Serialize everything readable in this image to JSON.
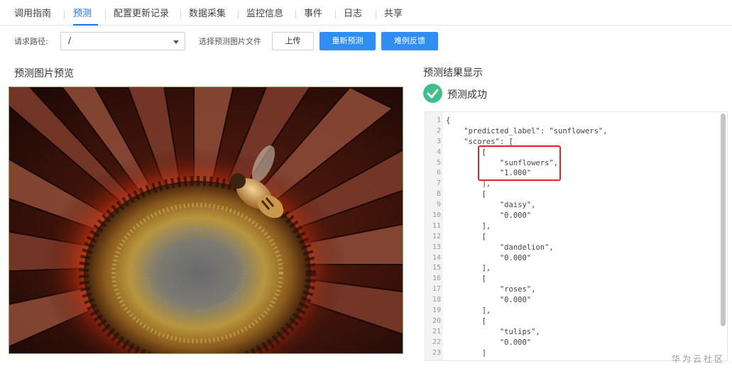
{
  "tabs": [
    {
      "label": "调用指南"
    },
    {
      "label": "预测"
    },
    {
      "label": "配置更新记录"
    },
    {
      "label": "数据采集"
    },
    {
      "label": "监控信息"
    },
    {
      "label": "事件"
    },
    {
      "label": "日志"
    },
    {
      "label": "共享"
    }
  ],
  "active_tab": "预测",
  "accent_color": "#1a72e8",
  "toolbar": {
    "path_label": "请求路径:",
    "path_value": "/",
    "file_label": "选择预测图片文件",
    "upload_button": "上传",
    "repredict_button": "重新预测",
    "feedback_button": "难例反馈"
  },
  "preview": {
    "title": "预测图片预览"
  },
  "result": {
    "title": "预测结果显示",
    "status_text": "预测成功",
    "status_color": "#3fbf8a"
  },
  "code_lines": [
    {
      "num": "1",
      "text": "{"
    },
    {
      "num": "2",
      "text": "    \"predicted_label\": \"sunflowers\","
    },
    {
      "num": "3",
      "text": "    \"scores\": ["
    },
    {
      "num": "4",
      "text": "        ["
    },
    {
      "num": "5",
      "text": "            \"sunflowers\","
    },
    {
      "num": "6",
      "text": "            \"1.000\""
    },
    {
      "num": "7",
      "text": "        ],"
    },
    {
      "num": "8",
      "text": "        ["
    },
    {
      "num": "9",
      "text": "            \"daisy\","
    },
    {
      "num": "10",
      "text": "            \"0.000\""
    },
    {
      "num": "11",
      "text": "        ],"
    },
    {
      "num": "12",
      "text": "        ["
    },
    {
      "num": "13",
      "text": "            \"dandelion\","
    },
    {
      "num": "14",
      "text": "            \"0.000\""
    },
    {
      "num": "15",
      "text": "        ],"
    },
    {
      "num": "16",
      "text": "        ["
    },
    {
      "num": "17",
      "text": "            \"roses\","
    },
    {
      "num": "18",
      "text": "            \"0.000\""
    },
    {
      "num": "19",
      "text": "        ],"
    },
    {
      "num": "20",
      "text": "        ["
    },
    {
      "num": "21",
      "text": "            \"tulips\","
    },
    {
      "num": "22",
      "text": "            \"0.000\""
    },
    {
      "num": "23",
      "text": "        ]"
    }
  ],
  "watermark": "华为云社区"
}
